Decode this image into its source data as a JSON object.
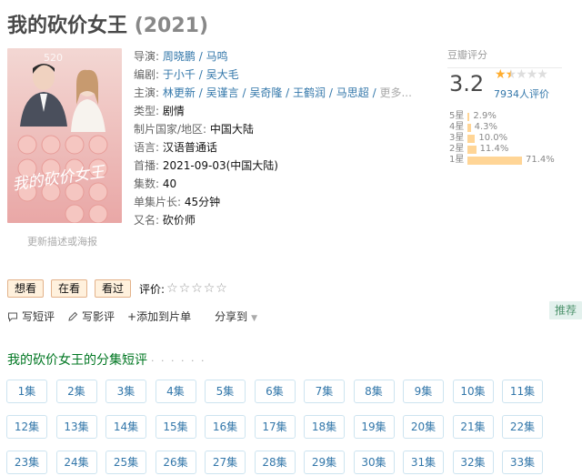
{
  "title": "我的砍价女王",
  "year": "(2021)",
  "poster": {
    "title_lettering": "我的砍价女王",
    "top_lettering": "520",
    "update_link": "更新描述或海报"
  },
  "info": {
    "director_label": "导演:",
    "directors": [
      "周晓鹏",
      "马鸣"
    ],
    "writer_label": "编剧:",
    "writers": [
      "于小千",
      "吴大毛"
    ],
    "cast_label": "主演:",
    "cast": [
      "林更新",
      "吴谨言",
      "吴奇隆",
      "王鹤润",
      "马思超"
    ],
    "cast_more": "更多...",
    "genre_label": "类型:",
    "genre": "剧情",
    "country_label": "制片国家/地区:",
    "country": "中国大陆",
    "language_label": "语言:",
    "language": "汉语普通话",
    "premiere_label": "首播:",
    "premiere": "2021-09-03(中国大陆)",
    "episodes_label": "集数:",
    "episodes": "40",
    "length_label": "单集片长:",
    "length": "45分钟",
    "aka_label": "又名:",
    "aka": "砍价师"
  },
  "rating": {
    "label": "豆瓣评分",
    "score": "3.2",
    "stars_filled": 1.5,
    "votes": "7934人评价",
    "distribution": [
      {
        "label": "5星",
        "percent": 2.9,
        "text": "2.9%"
      },
      {
        "label": "4星",
        "percent": 4.3,
        "text": "4.3%"
      },
      {
        "label": "3星",
        "percent": 10.0,
        "text": "10.0%"
      },
      {
        "label": "2星",
        "percent": 11.4,
        "text": "11.4%"
      },
      {
        "label": "1星",
        "percent": 71.4,
        "text": "71.4%"
      }
    ]
  },
  "buttons": {
    "want": "想看",
    "watching": "在看",
    "watched": "看过",
    "rate_label": "评价:"
  },
  "actions": {
    "short_review": "写短评",
    "review": "写影评",
    "add_list": "+添加到片单",
    "share": "分享到",
    "recommend": "推荐"
  },
  "episodes_section": {
    "title": "我的砍价女王的分集短评",
    "dots": "· · · · · ·",
    "items": [
      "1集",
      "2集",
      "3集",
      "4集",
      "5集",
      "6集",
      "7集",
      "8集",
      "9集",
      "10集",
      "11集",
      "12集",
      "13集",
      "14集",
      "15集",
      "16集",
      "17集",
      "18集",
      "19集",
      "20集",
      "21集",
      "22集",
      "23集",
      "24集",
      "25集",
      "26集",
      "27集",
      "28集",
      "29集",
      "30集",
      "31集",
      "32集",
      "33集"
    ]
  },
  "colors": {
    "link": "#3377aa",
    "star": "#ffac2d",
    "bar": "#ffd596",
    "section_green": "#007722",
    "button_bg": "#fff1dd"
  }
}
